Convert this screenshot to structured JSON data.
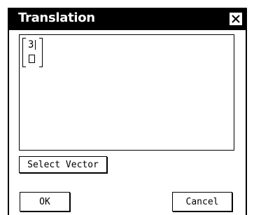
{
  "dialog": {
    "title": "Translation",
    "close_icon": "close-icon"
  },
  "editor": {
    "matrix": {
      "top_value": "3",
      "bottom_value": ""
    }
  },
  "buttons": {
    "select_vector": "Select Vector",
    "ok": "OK",
    "cancel": "Cancel"
  }
}
